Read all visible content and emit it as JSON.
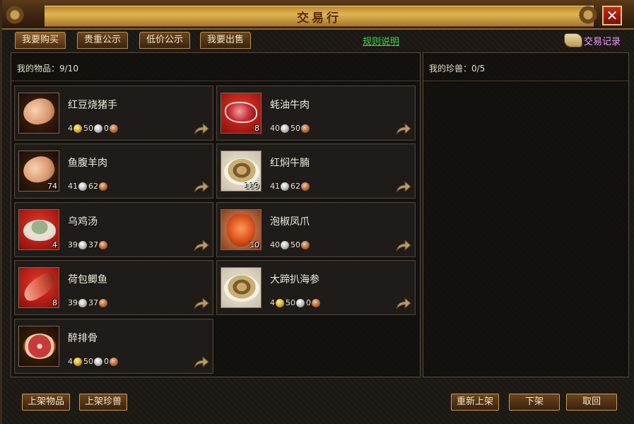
{
  "window": {
    "title": "交易行",
    "close_label": "✕"
  },
  "tabs": [
    {
      "label": "我要购买"
    },
    {
      "label": "贵重公示"
    },
    {
      "label": "低价公示"
    },
    {
      "label": "我要出售"
    }
  ],
  "rules_link": "规则说明",
  "trade_record": "交易记录",
  "left_panel": {
    "header": "我的物品：9/10"
  },
  "right_panel": {
    "header": "我的珍兽：0/5"
  },
  "items": [
    {
      "name": "红豆烧猪手",
      "qty": "",
      "gold": "4",
      "silver": "50",
      "copper": "0",
      "icon": "braised-pork-icon"
    },
    {
      "name": "蚝油牛肉",
      "qty": "8",
      "gold": "",
      "silver": "40",
      "copper": "50",
      "icon": "beef-icon"
    },
    {
      "name": "鱼腹羊肉",
      "qty": "74",
      "gold": "",
      "silver": "41",
      "copper": "62",
      "icon": "mutton-icon"
    },
    {
      "name": "红焖牛腩",
      "qty": "119",
      "gold": "",
      "silver": "41",
      "copper": "62",
      "icon": "braised-beef-icon"
    },
    {
      "name": "乌鸡汤",
      "qty": "4",
      "gold": "",
      "silver": "39",
      "copper": "37",
      "icon": "chicken-soup-icon"
    },
    {
      "name": "泡椒凤爪",
      "qty": "10",
      "gold": "",
      "silver": "40",
      "copper": "50",
      "icon": "chicken-feet-icon"
    },
    {
      "name": "荷包鲫鱼",
      "qty": "8",
      "gold": "",
      "silver": "39",
      "copper": "37",
      "icon": "fish-icon"
    },
    {
      "name": "大蹄扒海参",
      "qty": "",
      "gold": "4",
      "silver": "50",
      "copper": "0",
      "icon": "sea-cucumber-icon"
    },
    {
      "name": "醉排骨",
      "qty": "",
      "gold": "4",
      "silver": "50",
      "copper": "0",
      "icon": "ribs-icon"
    }
  ],
  "buttons": {
    "list_item": "上架物品",
    "list_pet": "上架珍兽",
    "relist": "重新上架",
    "delist": "下架",
    "cancel": "取回"
  }
}
